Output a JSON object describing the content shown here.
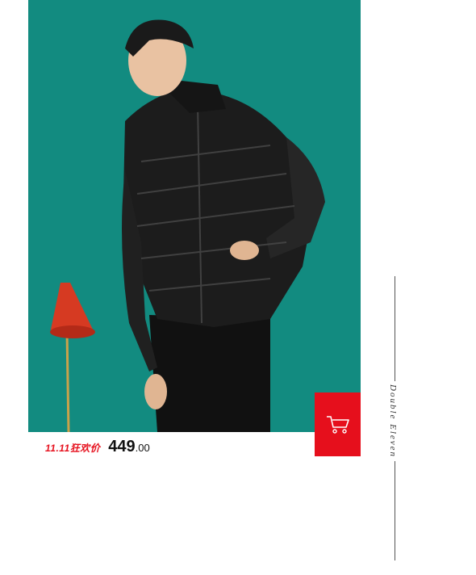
{
  "product": {
    "promo_label": "11.11狂欢价",
    "price_main": "449",
    "price_cents": ".00",
    "image_alt": "man in black quilted down jacket"
  },
  "cart": {
    "icon": "shopping-cart-icon"
  },
  "side_text": "Double Eleven",
  "colors": {
    "accent": "#e60f1c",
    "photo_bg": "#138f84"
  }
}
